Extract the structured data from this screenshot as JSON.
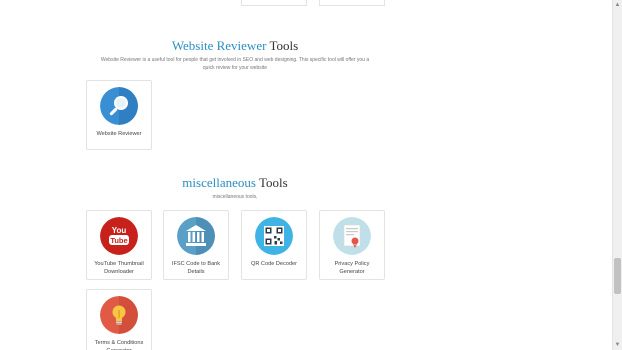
{
  "sections": [
    {
      "title_accent": "Website Reviewer",
      "title_rest": "Tools",
      "description": "Website Reviewer is a useful tool for people that get involved in SEO and web designing. This specific tool will offer you a quick review for your website",
      "tools": [
        {
          "label": "Website Reviewer",
          "icon": "magnifier-icon",
          "color": "#3a8fd4"
        }
      ]
    },
    {
      "title_accent": "miscellaneous",
      "title_rest": "Tools",
      "description": "miscellaneous tools,",
      "tools": [
        {
          "label": "YouTube Thumbnail Downloader",
          "icon": "youtube-icon",
          "color": "#d63a2e"
        },
        {
          "label": "IFSC Code to Bank Details",
          "icon": "bank-icon",
          "color": "#5a9fc8"
        },
        {
          "label": "QR Code Decoder",
          "icon": "qr-code-icon",
          "color": "#3fb3e3"
        },
        {
          "label": "Privacy Policy Generator",
          "icon": "certificate-icon",
          "color": "#bfe0e8"
        },
        {
          "label": "Terms & Conditions Generator",
          "icon": "lightbulb-icon",
          "color": "#e05a45"
        }
      ]
    }
  ]
}
